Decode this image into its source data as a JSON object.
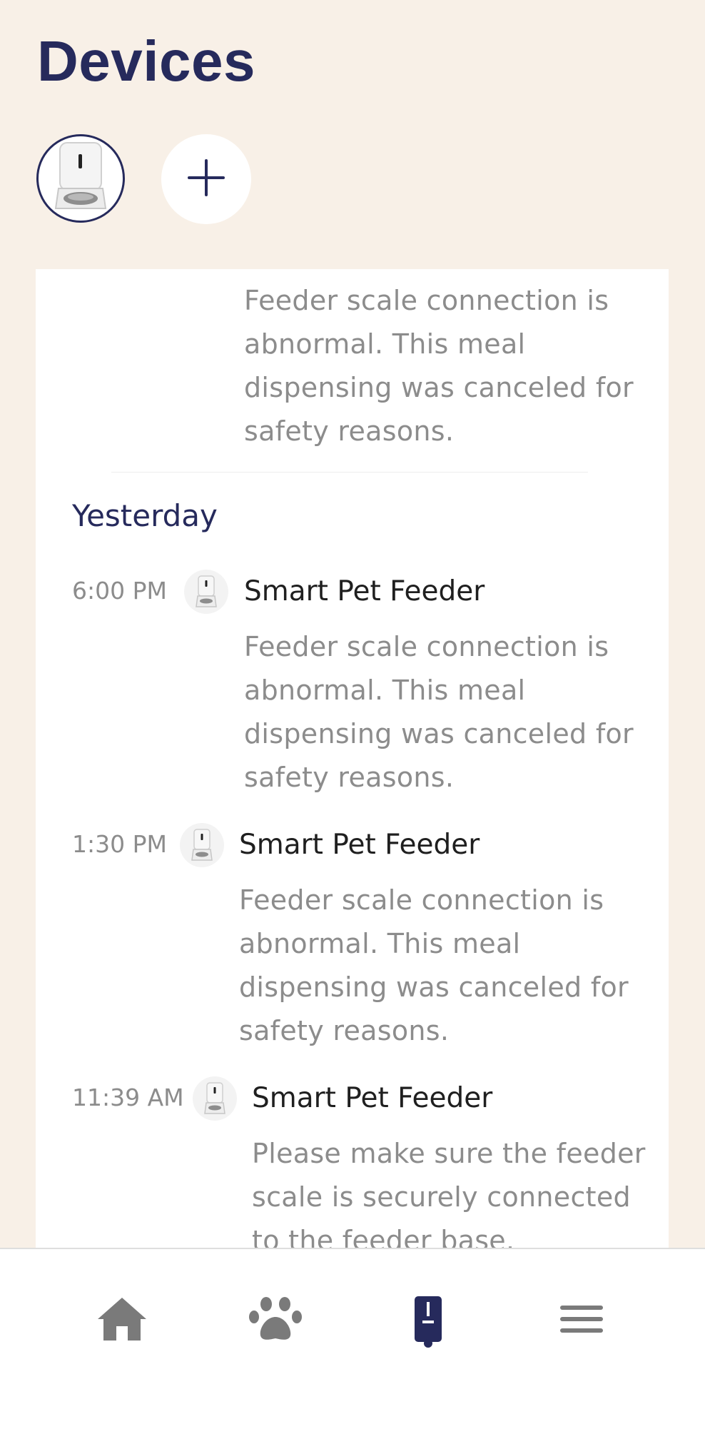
{
  "header": {
    "title": "Devices"
  },
  "devices": {
    "selected_icon": "pet-feeder-icon",
    "add_icon": "plus-icon"
  },
  "feed": {
    "top_message": "Feeder scale connection is abnormal. This meal dispensing was canceled for safety reasons.",
    "section_label": "Yesterday",
    "items": [
      {
        "time": "6:00 PM",
        "device": "Smart Pet Feeder",
        "message": "Feeder scale connection is abnormal. This meal dispensing was canceled for safety reasons."
      },
      {
        "time": "1:30 PM",
        "device": "Smart Pet Feeder",
        "message": "Feeder scale connection is abnormal. This meal dispensing was canceled for safety reasons."
      },
      {
        "time": "11:39 AM",
        "device": "Smart Pet Feeder",
        "message": "Please make sure the feeder scale is securely connected to the feeder base."
      }
    ]
  },
  "tabbar": {
    "tabs": [
      {
        "icon": "home-icon",
        "active": false
      },
      {
        "icon": "paw-icon",
        "active": false
      },
      {
        "icon": "device-icon",
        "active": true
      },
      {
        "icon": "menu-icon",
        "active": false
      }
    ]
  },
  "colors": {
    "background": "#f8f0e7",
    "accent": "#262a5c",
    "muted_text": "#8c8c8c",
    "tab_icon_inactive": "#7a7a7a"
  }
}
